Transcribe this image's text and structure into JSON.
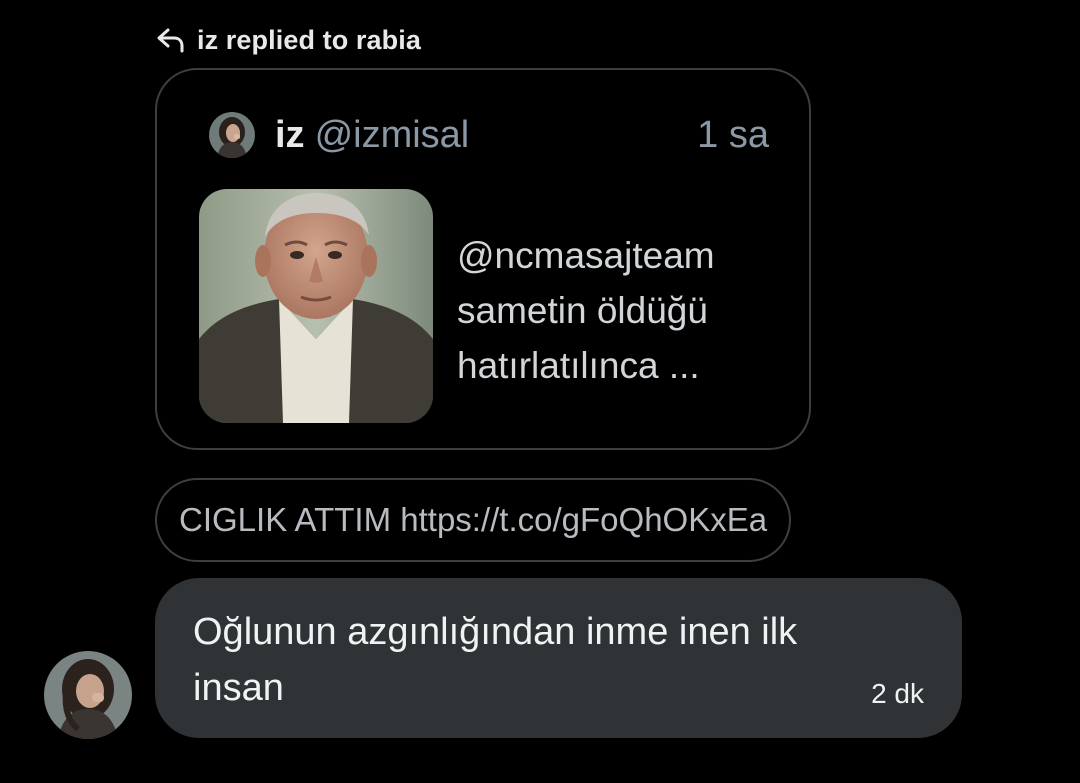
{
  "reply_context": {
    "icon": "reply-arrow-icon",
    "text": "iz replied to rabia"
  },
  "quoted_tweet": {
    "author_name": "iz",
    "author_handle": "@izmisal",
    "time": "1 sa",
    "avatar_icon": "user-avatar",
    "thumbnail_icon": "man-in-suit-photo",
    "text_lines": [
      "@ncmasajteam",
      "sametin öldüğü",
      "hatırlatılınca ..."
    ]
  },
  "link_pill": {
    "text": "CIGLIK ATTIM https://t.co/gFoQhOKxEa"
  },
  "message": {
    "text": "Oğlunun azgınlığından inme inen ilk insan",
    "time": "2 dk",
    "sender_avatar_icon": "user-avatar"
  },
  "colors": {
    "background": "#000000",
    "bubble": "#2f3336",
    "border": "#3a3f44",
    "secondary_text": "#8b98a5"
  }
}
